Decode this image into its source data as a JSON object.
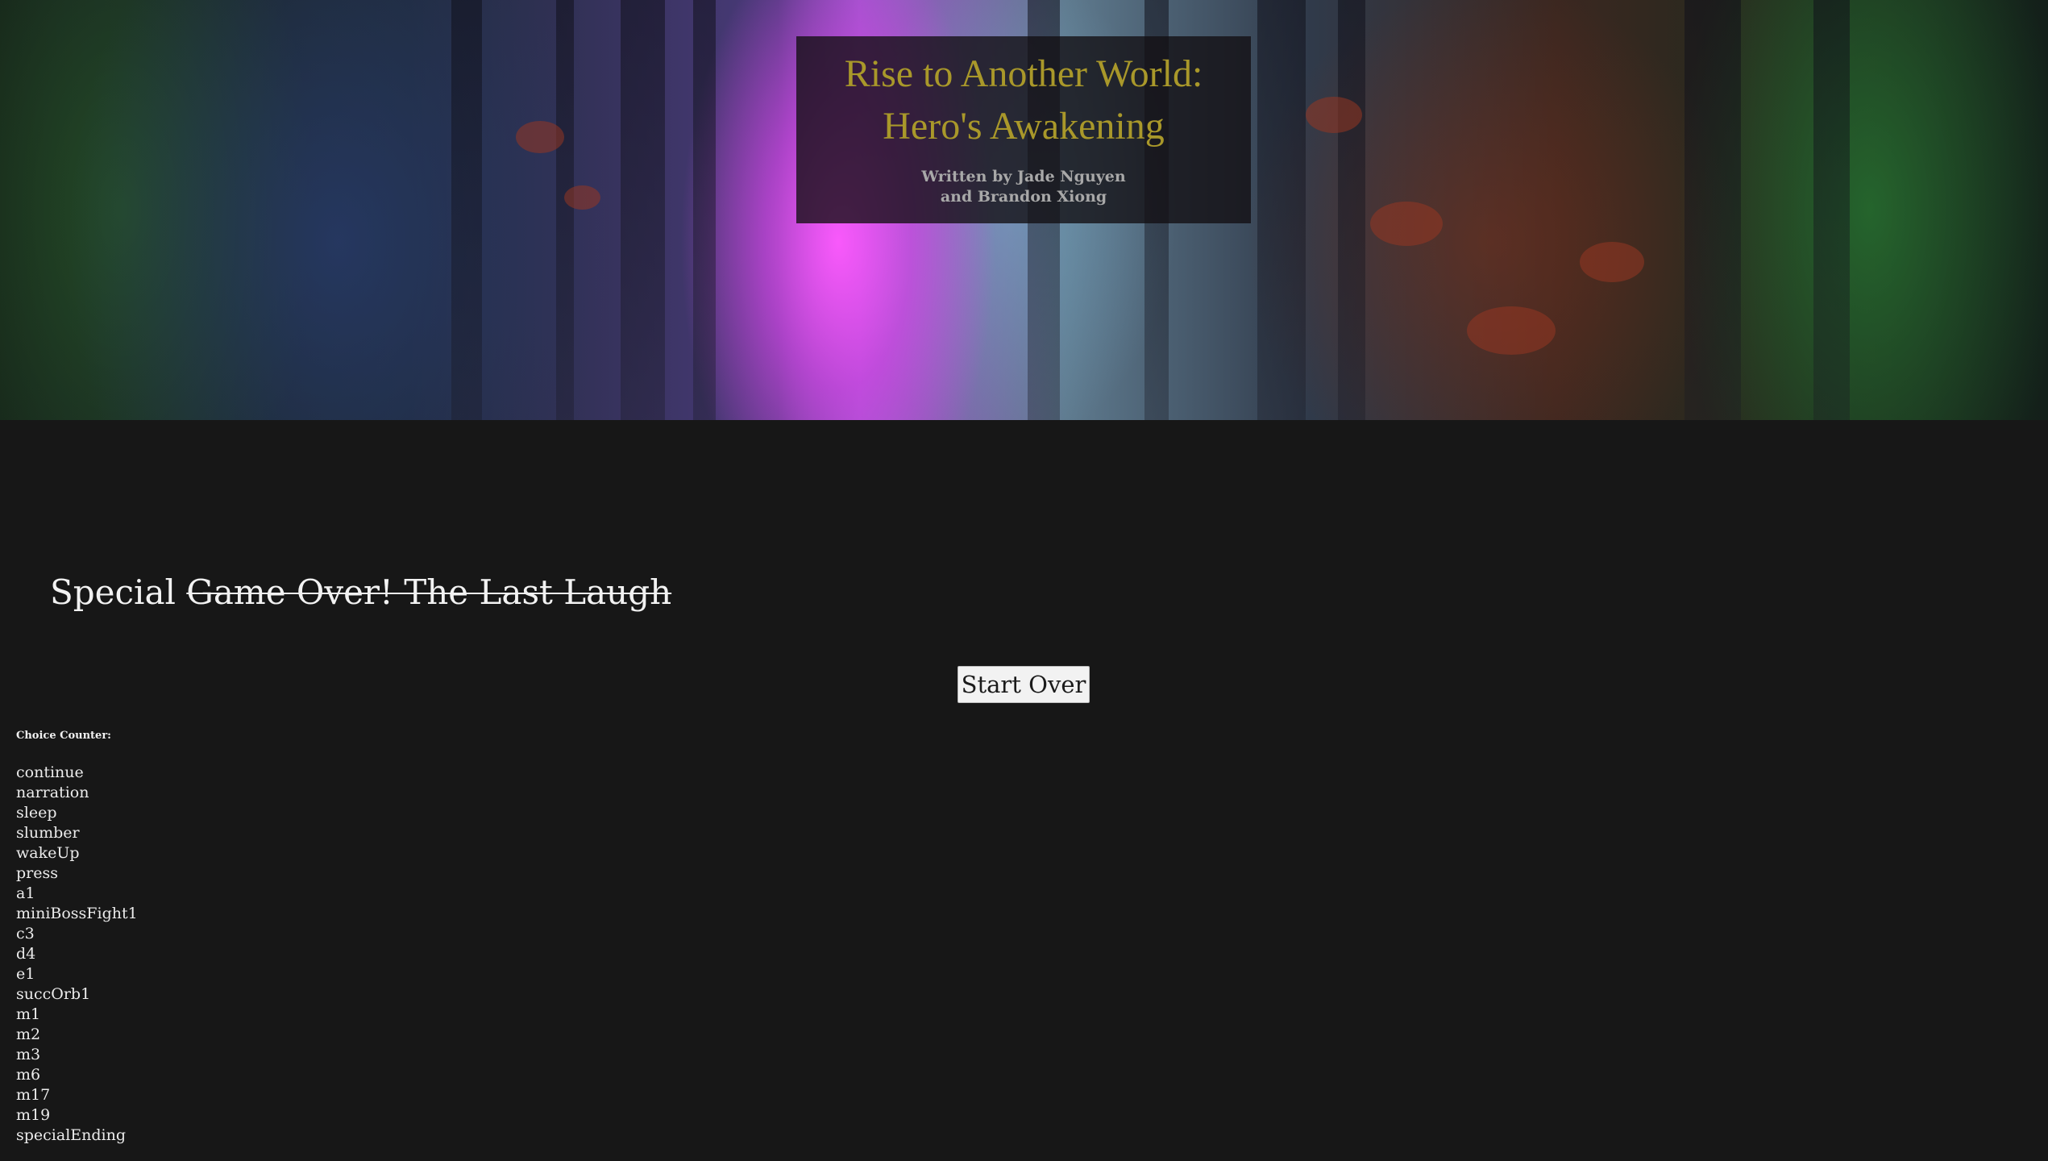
{
  "header": {
    "title_line1": "Rise to Another World:",
    "title_line2": "Hero's Awakening",
    "credit_line1": "Written by Jade Nguyen",
    "credit_line2": "and Brandon Xiong"
  },
  "ending": {
    "prefix": "Special ",
    "title": "Game Over! The Last Laugh"
  },
  "controls": {
    "start_over_label": "Start Over"
  },
  "choice_counter": {
    "label": "Choice Counter:",
    "choices": [
      "continue",
      "narration",
      "sleep",
      "slumber",
      "wakeUp",
      "press",
      "a1",
      "miniBossFight1",
      "c3",
      "d4",
      "e1",
      "succOrb1",
      "m1",
      "m2",
      "m3",
      "m6",
      "m17",
      "m19",
      "specialEnding"
    ]
  },
  "colors": {
    "title_gold": "#a9982a",
    "page_background": "#171717"
  }
}
